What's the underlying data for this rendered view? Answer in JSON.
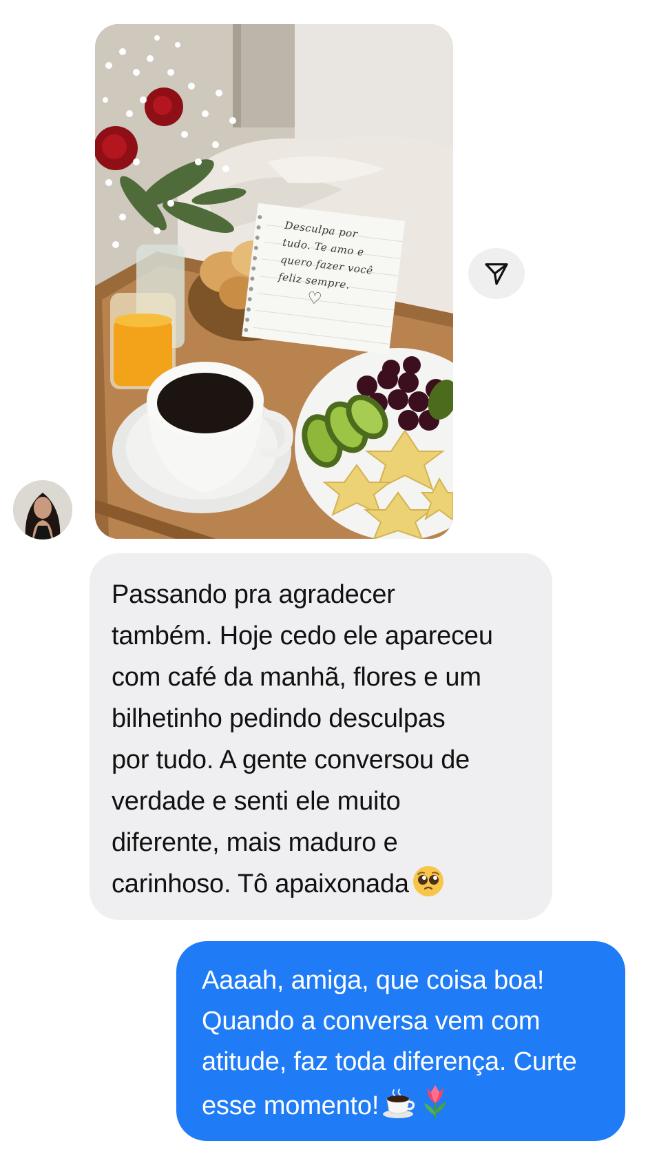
{
  "conversation": {
    "photo": {
      "note_lines": [
        "Desculpa por",
        "tudo. Te amo e",
        "quero fazer você",
        "feliz sempre."
      ],
      "note_heart": "♡"
    },
    "share_button": {
      "icon": "send-paper-plane-icon"
    },
    "received": {
      "text": "Passando pra agradecer\ntambém. Hoje cedo ele apareceu\ncom café da manhã, flores e um\nbilhetinho pedindo desculpas\npor tudo. A gente conversou de\nverdade e senti ele muito\ndiferente, mais maduro e\ncarinhoso. Tô apaixonada",
      "emoji": "pleading-face-emoji"
    },
    "sent": {
      "text": "Aaaah, amiga, que coisa boa!\nQuando a conversa vem com\natitude, faz toda diferença. Curte\nesse momento!",
      "emojis": [
        "coffee-emoji",
        "tulip-emoji"
      ]
    }
  },
  "colors": {
    "sent_bubble": "#1f7bf6",
    "received_bubble": "#efeff1",
    "share_button_bg": "#efefef",
    "text_dark": "#111111",
    "text_light": "#ffffff"
  }
}
